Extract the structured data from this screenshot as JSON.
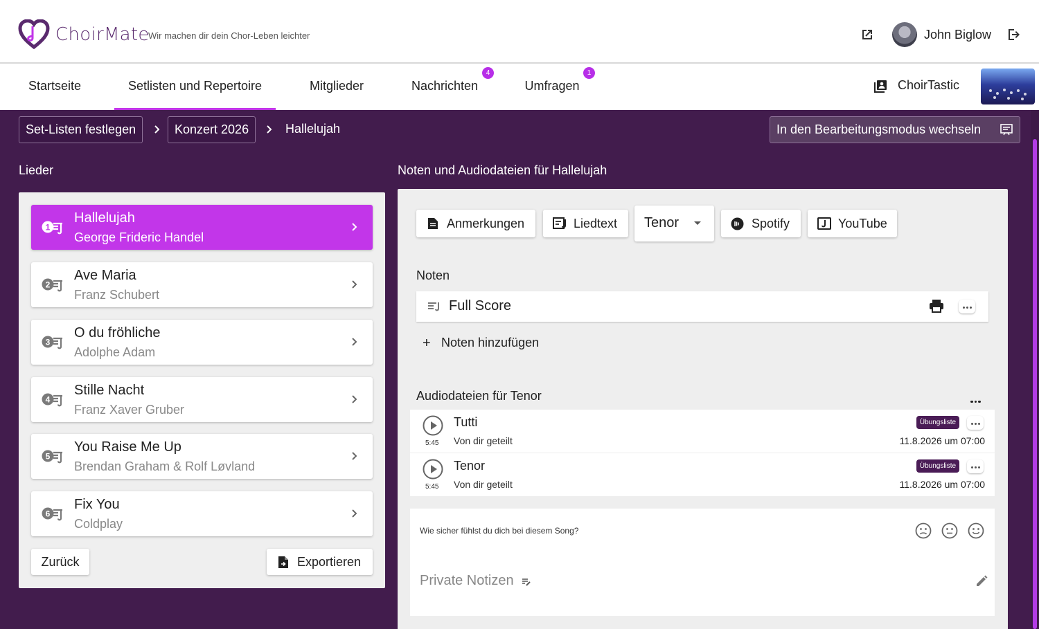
{
  "app": {
    "name": "ChoirMate",
    "tagline": "Wir machen dir dein Chor-Leben leichter",
    "brand_color": "#c236e9",
    "dark_color": "#421c4d"
  },
  "user": {
    "name": "John Biglow"
  },
  "tabs": [
    {
      "label": "Startseite"
    },
    {
      "label": "Setlisten und Repertoire",
      "active": true
    },
    {
      "label": "Mitglieder"
    },
    {
      "label": "Nachrichten",
      "badge": "4"
    },
    {
      "label": "Umfragen",
      "badge": "1"
    }
  ],
  "choir": {
    "name": "ChoirTastic"
  },
  "breadcrumb": {
    "items": [
      "Set-Listen festlegen",
      "Konzert 2026"
    ],
    "current": "Hallelujah"
  },
  "edit_mode_label": "In den Bearbeitungsmodus wechseln",
  "songs_section": {
    "title": "Lieder",
    "songs": [
      {
        "number": "1",
        "title": "Hallelujah",
        "artist": "George Frideric Handel",
        "active": true
      },
      {
        "number": "2",
        "title": "Ave Maria",
        "artist": "Franz Schubert"
      },
      {
        "number": "3",
        "title": "O du fröhliche",
        "artist": "Adolphe Adam"
      },
      {
        "number": "4",
        "title": "Stille Nacht",
        "artist": "Franz Xaver Gruber"
      },
      {
        "number": "5",
        "title": "You Raise Me Up",
        "artist": "Brendan Graham & Rolf Løvland"
      },
      {
        "number": "6",
        "title": "Fix You",
        "artist": "Coldplay"
      }
    ],
    "back_label": "Zurück",
    "export_label": "Exportieren"
  },
  "details": {
    "title": "Noten und Audiodateien für Hallelujah",
    "buttons": {
      "notes": "Anmerkungen",
      "lyrics": "Liedtext",
      "voice": "Tenor",
      "spotify": "Spotify",
      "youtube": "YouTube"
    },
    "scores_title": "Noten",
    "scores": [
      {
        "name": "Full Score"
      }
    ],
    "add_score_label": "Noten hinzufügen",
    "audio_title": "Audiodateien für Tenor",
    "audio": [
      {
        "name": "Tutti",
        "duration": "5:45",
        "shared": "Von dir geteilt",
        "tag": "Übungsliste",
        "date": "11.8.2026 um 07:00"
      },
      {
        "name": "Tenor",
        "duration": "5:45",
        "shared": "Von dir geteilt",
        "tag": "Übungsliste",
        "date": "11.8.2026 um 07:00"
      }
    ],
    "confidence_question": "Wie sicher fühlst du dich bei diesem Song?",
    "private_notes_label": "Private Notizen"
  }
}
